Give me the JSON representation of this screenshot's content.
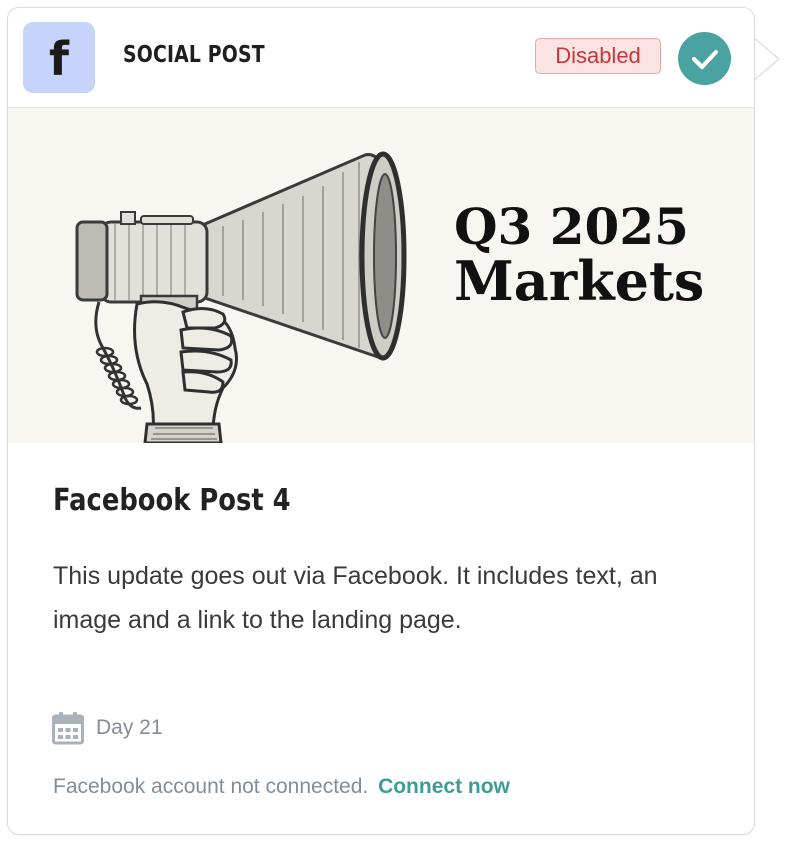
{
  "header": {
    "icon_letter": "f",
    "icon": "facebook-logo-icon",
    "title": "SOCIAL POST",
    "status_label": "Disabled",
    "status_icon": "checkmark-icon"
  },
  "banner": {
    "line1": "Q3 2025",
    "line2": "Markets",
    "illustration": "megaphone-hand-illustration"
  },
  "post": {
    "title": "Facebook Post 4",
    "description": "This update goes out via Facebook. It includes text, an image and a link to the landing page."
  },
  "schedule": {
    "icon": "calendar-icon",
    "day_label": "Day 21"
  },
  "footer": {
    "message": "Facebook account not connected.",
    "link_label": "Connect now"
  },
  "colors": {
    "accent_teal": "#4aa3a0",
    "link_teal": "#3e9b96",
    "badge_bg": "#fbe3e3",
    "badge_text": "#c9363a",
    "icon_tile": "#c6d3fb",
    "banner_bg": "#f8f6f0",
    "muted_text": "#838d99"
  }
}
